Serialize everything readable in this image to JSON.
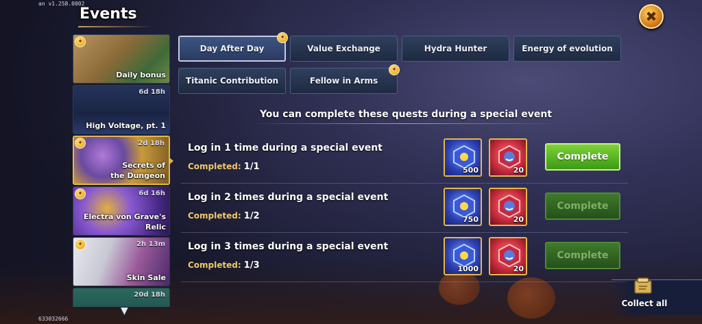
{
  "meta": {
    "version": "an v1.258.0002",
    "build_id": "633032666"
  },
  "header": {
    "title": "Events",
    "close_icon": "close-icon"
  },
  "sidebar": {
    "items": [
      {
        "name": "Daily bonus",
        "timer": "",
        "badge": true
      },
      {
        "name": "High Voltage, pt. 1",
        "timer": "6d 18h",
        "badge": false
      },
      {
        "name": "Secrets of the Dungeon",
        "timer": "2d 18h",
        "badge": true,
        "active": true
      },
      {
        "name": "Electra von Grave's Relic",
        "timer": "6d 16h",
        "badge": true
      },
      {
        "name": "Skin Sale",
        "timer": "2h 13m",
        "badge": true
      },
      {
        "name": "",
        "timer": "20d 18h",
        "badge": false
      }
    ],
    "scroll_icon": "chevron-down-icon"
  },
  "tabs": [
    {
      "label": "Day After Day",
      "active": true,
      "badge": true
    },
    {
      "label": "Value Exchange",
      "active": false,
      "badge": false
    },
    {
      "label": "Hydra Hunter",
      "active": false,
      "badge": false
    },
    {
      "label": "Energy of evolution",
      "active": false,
      "badge": false
    },
    {
      "label": "Titanic Contribution",
      "active": false,
      "badge": false
    },
    {
      "label": "Fellow in Arms",
      "active": false,
      "badge": true
    }
  ],
  "main": {
    "subtitle": "You can complete these quests during a special event"
  },
  "quests": [
    {
      "title": "Log in 1 time during a special event",
      "progress_label": "Completed:",
      "progress": "1/1",
      "rewards": [
        {
          "type": "blue-gem",
          "amount": "500"
        },
        {
          "type": "red-token",
          "amount": "20"
        }
      ],
      "button": "Complete",
      "enabled": true
    },
    {
      "title": "Log in 2 times during a special event",
      "progress_label": "Completed:",
      "progress": "1/2",
      "rewards": [
        {
          "type": "blue-gem",
          "amount": "750"
        },
        {
          "type": "red-token",
          "amount": "20"
        }
      ],
      "button": "Complete",
      "enabled": false
    },
    {
      "title": "Log in 3 times during a special event",
      "progress_label": "Completed:",
      "progress": "1/3",
      "rewards": [
        {
          "type": "blue-gem",
          "amount": "1000"
        },
        {
          "type": "red-token",
          "amount": "20"
        }
      ],
      "button": "Complete",
      "enabled": false
    }
  ],
  "footer": {
    "collect_all": "Collect all",
    "collect_icon": "scroll-icon"
  },
  "colors": {
    "accent_gold": "#e6b84a",
    "button_green": "#5cb82a",
    "tab_blue": "#2f3f5c"
  }
}
